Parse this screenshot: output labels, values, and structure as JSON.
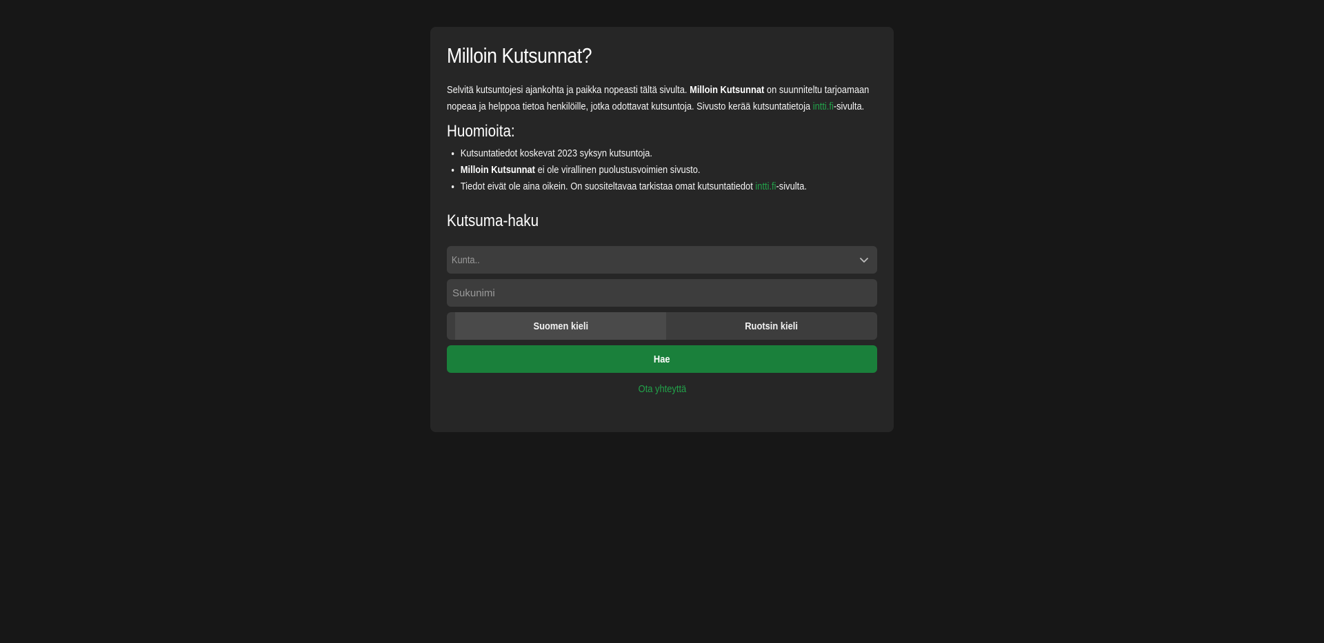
{
  "colors": {
    "background": "#171717",
    "card": "#262626",
    "input": "#3d3d3d",
    "accent": "#1a803b",
    "link": "#22a34a"
  },
  "header": {
    "title": "Milloin Kutsunnat?"
  },
  "intro": {
    "part1": "Selvitä kutsuntojesi ajankohta ja paikka nopeasti tältä sivulta. ",
    "brand": "Milloin Kutsunnat",
    "part2": " on suunniteltu tarjoamaan nopeaa ja helppoa tietoa henkilöille, jotka odottavat kutsuntoja. Sivusto kerää kutsuntatietoja ",
    "link_text": "intti.fi",
    "part3": "-sivulta."
  },
  "notes": {
    "title": "Huomioita:",
    "item1": "Kutsuntatiedot koskevat 2023 syksyn kutsuntoja.",
    "item2_brand": "Milloin Kutsunnat",
    "item2_rest": " ei ole virallinen puolustusvoimien sivusto.",
    "item3_part1": "Tiedot eivät ole aina oikein. On suositeltavaa tarkistaa omat kutsuntatiedot ",
    "item3_link": "intti.fi",
    "item3_part2": "-sivulta."
  },
  "search": {
    "title": "Kutsuma-haku",
    "municipality_placeholder": "Kunta..",
    "surname_placeholder": "Sukunimi",
    "language_options": [
      "Suomen kieli",
      "Ruotsin kieli"
    ],
    "selected_language": "Suomen kieli",
    "submit_label": "Hae",
    "contact_label": "Ota yhteyttä"
  }
}
